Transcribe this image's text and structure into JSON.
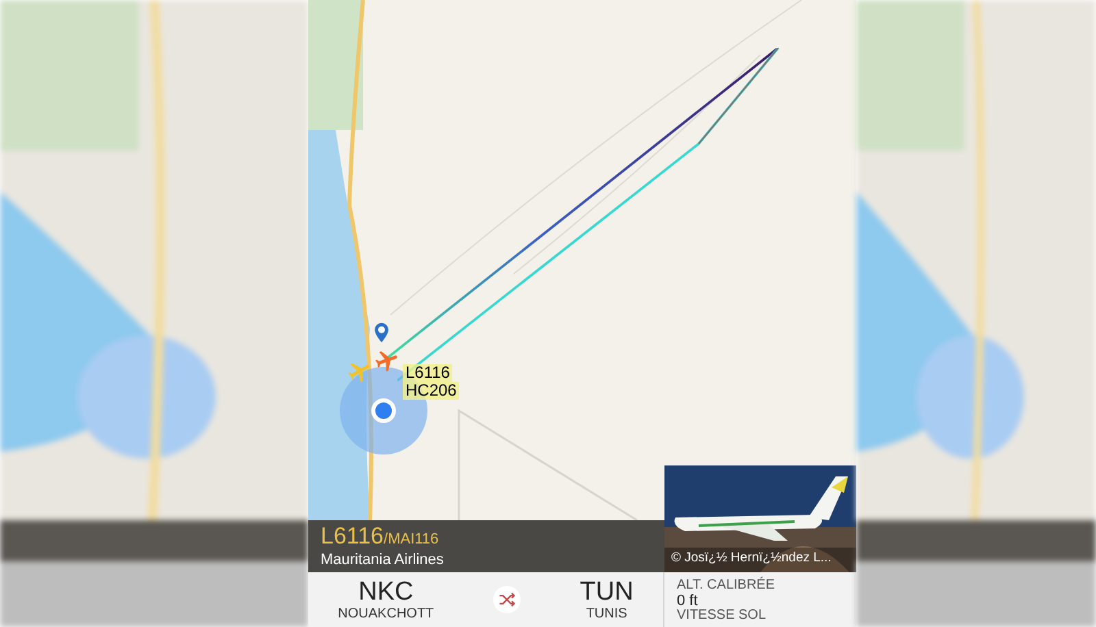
{
  "map": {
    "flights": [
      {
        "label": "L6116",
        "color": "#f26b2a"
      },
      {
        "label": "HC206",
        "color": "#f2c22a"
      }
    ]
  },
  "flight_panel": {
    "flight_number": "L6116",
    "callsign": "/MAI116",
    "airline": "Mauritania Airlines",
    "photo": {
      "kind": "picture",
      "credit": "© Josï¿½ Hernï¿½ndez L..."
    }
  },
  "route": {
    "origin": {
      "code": "NKC",
      "name": "NOUAKCHOTT"
    },
    "destination": {
      "code": "TUN",
      "name": "TUNIS"
    }
  },
  "stats": [
    {
      "label": "ALT. CALIBRÉE",
      "value": "0 ft"
    },
    {
      "label": "VITESSE SOL"
    }
  ]
}
